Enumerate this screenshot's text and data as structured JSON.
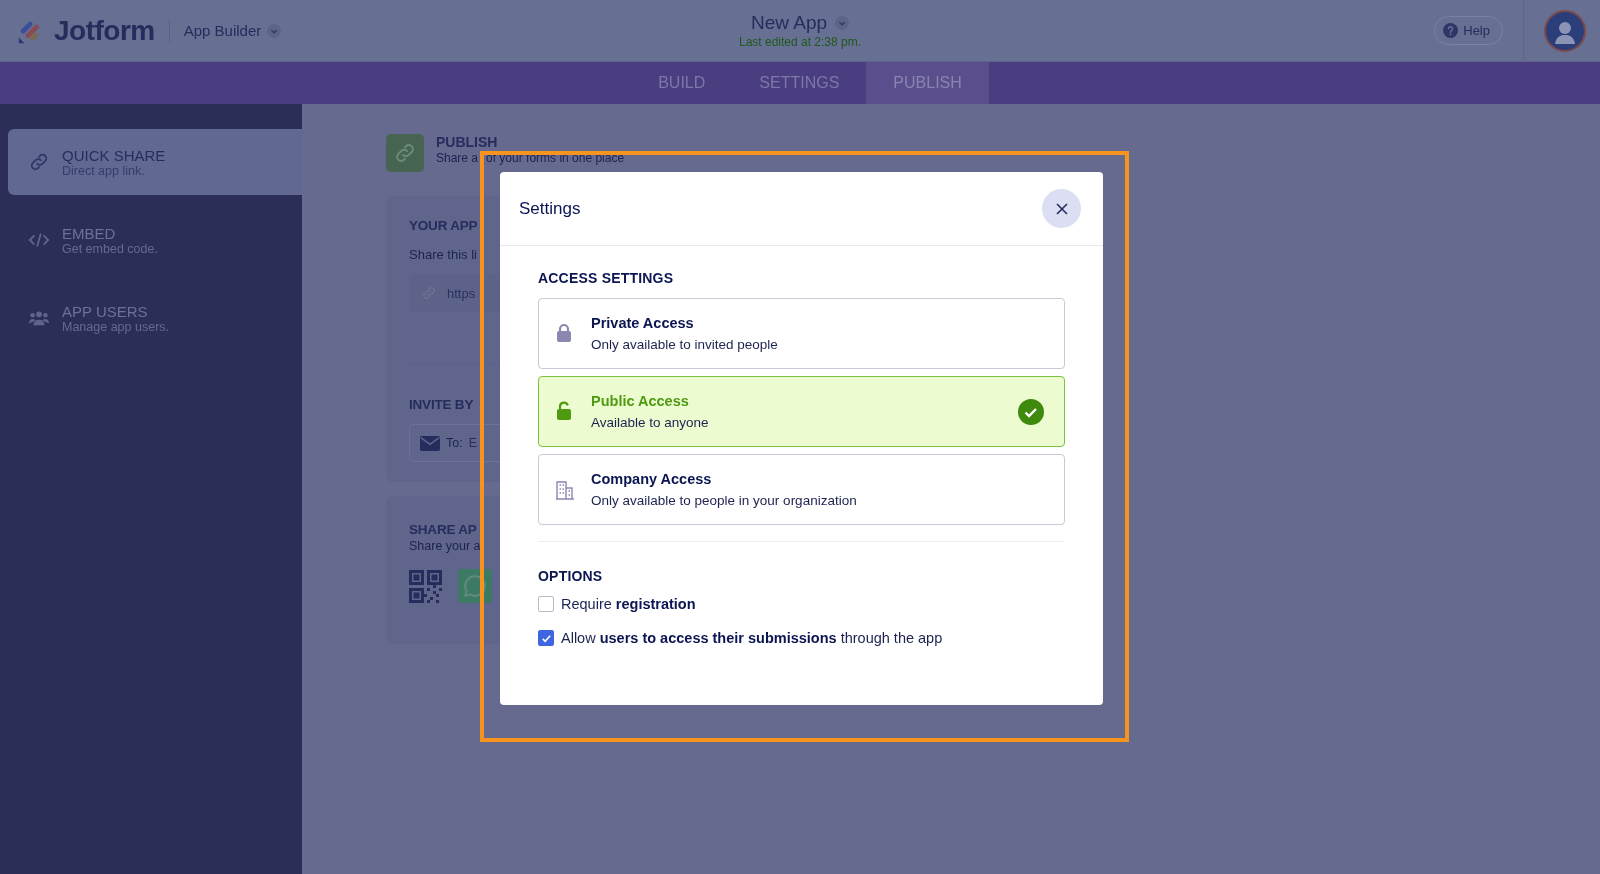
{
  "header": {
    "logo": "Jotform",
    "product": "App Builder",
    "app_title": "New App",
    "last_edited": "Last edited at 2:38 pm.",
    "help": "Help"
  },
  "tabs": [
    {
      "label": "BUILD",
      "selected": false
    },
    {
      "label": "SETTINGS",
      "selected": false
    },
    {
      "label": "PUBLISH",
      "selected": true
    }
  ],
  "sidebar": {
    "items": [
      {
        "kind": "link",
        "title": "QUICK SHARE",
        "subtitle": "Direct app link.",
        "selected": true
      },
      {
        "kind": "embed",
        "title": "EMBED",
        "subtitle": "Get embed code.",
        "selected": false
      },
      {
        "kind": "users",
        "title": "APP USERS",
        "subtitle": "Manage app users.",
        "selected": false
      }
    ]
  },
  "publish": {
    "title": "PUBLISH",
    "subtitle": [
      "Share a",
      "of your forms in one place"
    ],
    "app_link": {
      "heading": "YOUR APP",
      "text": "Share this li",
      "url": "https"
    },
    "invite": {
      "heading": "INVITE BY",
      "label": "To:",
      "placeholder": "E"
    },
    "share": {
      "heading": "SHARE AP",
      "text": "Share your a"
    }
  },
  "modal": {
    "title": "Settings",
    "access_heading": "ACCESS SETTINGS",
    "access_options": [
      {
        "kind": "private",
        "title": "Private Access",
        "description": "Only available to invited people",
        "selected": false
      },
      {
        "kind": "public",
        "title": "Public Access",
        "description": "Available to anyone",
        "selected": true
      },
      {
        "kind": "company",
        "title": "Company Access",
        "description": "Only available to people in your organization",
        "selected": false
      }
    ],
    "options_heading": "OPTIONS",
    "checkboxes": [
      {
        "label": "Require **registration**",
        "checked": false
      },
      {
        "label": "Allow **users to access their submissions** through the app",
        "checked": true
      }
    ]
  }
}
